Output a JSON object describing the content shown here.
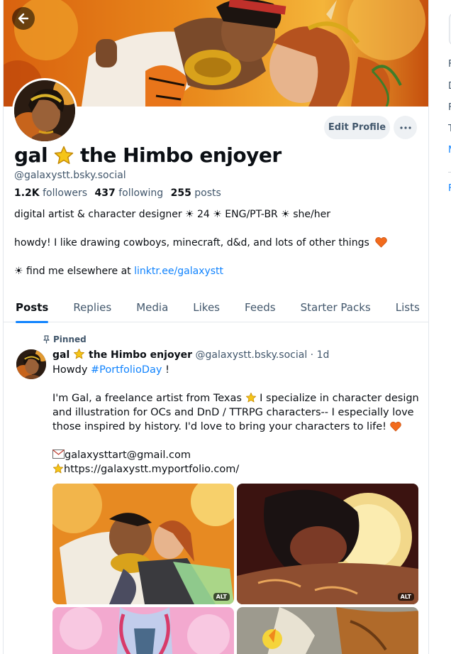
{
  "profile": {
    "display_name_part1": "gal",
    "display_name_part2": "the Himbo enjoyer",
    "handle": "@galaxystt.bsky.social",
    "followers_count": "1.2K",
    "followers_label": "followers",
    "following_count": "437",
    "following_label": "following",
    "posts_count": "255",
    "posts_label": "posts",
    "bio_line1": "digital artist & character designer  ☀  24  ☀  ENG/PT-BR  ☀  she/her",
    "bio_line2": "howdy! I like drawing cowboys, minecraft, d&d, and lots of other things",
    "bio_line3_prefix": "☀  find me elsewhere at ",
    "bio_link": "linktr.ee/galaxystt",
    "edit_label": "Edit Profile"
  },
  "tabs": [
    {
      "label": "Posts"
    },
    {
      "label": "Replies"
    },
    {
      "label": "Media"
    },
    {
      "label": "Likes"
    },
    {
      "label": "Feeds"
    },
    {
      "label": "Starter Packs"
    },
    {
      "label": "Lists"
    }
  ],
  "post": {
    "pinned_label": "Pinned",
    "author_part1": "gal",
    "author_part2": "the Himbo enjoyer",
    "author_handle": "@galaxystt.bsky.social",
    "time": "· 1d",
    "line1_prefix": "Howdy ",
    "line1_hashtag": "#PortfolioDay",
    "line1_suffix": " !",
    "line2": "I'm Gal, a freelance artist from Texas",
    "line2_suffix": " I specialize in character design",
    "line3": "and illustration for OCs and DnD / TTRPG characters-- I especially love",
    "line4": "those inspired by history. I'd love to bring your characters to life!",
    "email": "galaxysttart@gmail.com",
    "portfolio": "https://galaxystt.myportfolio.com/",
    "alt_badge": "ALT"
  },
  "right_strip": {
    "letters": [
      "F",
      "D",
      "F",
      "T",
      "M",
      "F"
    ]
  },
  "colors": {
    "accent": "#1083fe",
    "muted_text": "#42576c",
    "star": "#f5c518",
    "heart": "#f26b1d"
  },
  "icons": {
    "back": "left-arrow-icon",
    "more": "ellipsis-icon",
    "pinned": "pin-icon",
    "star": "star-emoji-icon",
    "heart": "orange-heart-icon",
    "mail": "envelope-icon"
  }
}
